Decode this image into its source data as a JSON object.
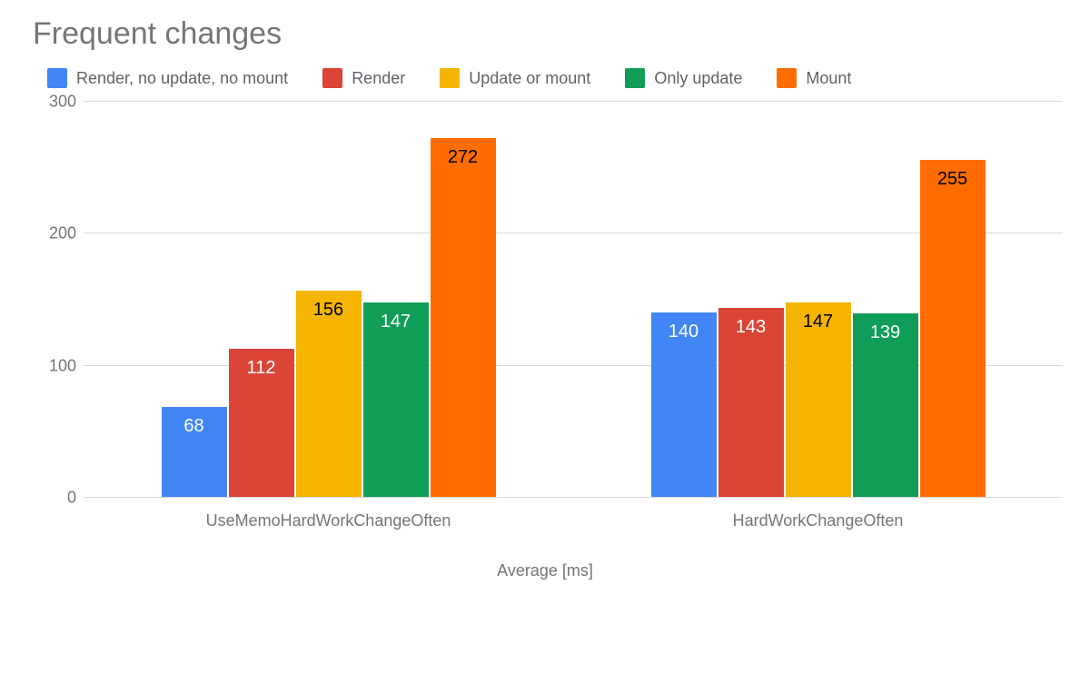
{
  "chart_data": {
    "type": "bar",
    "title": "Frequent changes",
    "xlabel": "Average [ms]",
    "ylabel": "",
    "ylim": [
      0,
      300
    ],
    "yticks": [
      0,
      100,
      200,
      300
    ],
    "categories": [
      "UseMemoHardWorkChangeOften",
      "HardWorkChangeOften"
    ],
    "series": [
      {
        "name": "Render, no update, no mount",
        "color": "#4285f4",
        "values": [
          68,
          140
        ]
      },
      {
        "name": "Render",
        "color": "#db4437",
        "values": [
          112,
          143
        ]
      },
      {
        "name": "Update or mount",
        "color": "#f4b400",
        "values": [
          156,
          147
        ]
      },
      {
        "name": "Only update",
        "color": "#0f9d58",
        "values": [
          147,
          139
        ]
      },
      {
        "name": "Mount",
        "color": "#ff6d00",
        "values": [
          272,
          255
        ]
      }
    ],
    "label_color_rule": {
      "dark_on": [
        "#f4b400",
        "#ff6d00"
      ],
      "light_on": [
        "#4285f4",
        "#db4437",
        "#0f9d58"
      ]
    }
  }
}
